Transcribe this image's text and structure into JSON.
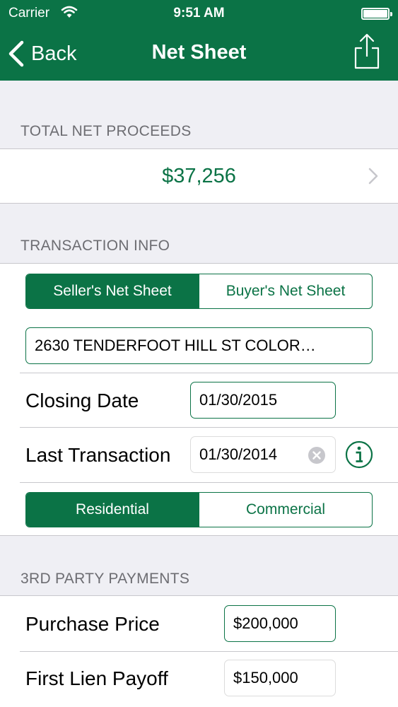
{
  "status_bar": {
    "carrier": "Carrier",
    "time": "9:51 AM"
  },
  "nav": {
    "back_label": "Back",
    "title": "Net Sheet"
  },
  "proceeds": {
    "header": "TOTAL NET PROCEEDS",
    "value": "$37,256"
  },
  "transaction": {
    "header": "TRANSACTION INFO",
    "sheet_type": {
      "options": [
        "Seller's Net Sheet",
        "Buyer's Net Sheet"
      ],
      "selected": "Seller's Net Sheet"
    },
    "address": "2630 TENDERFOOT HILL ST  COLOR…",
    "closing_date": {
      "label": "Closing Date",
      "value": "01/30/2015"
    },
    "last_transaction": {
      "label": "Last Transaction",
      "value": "01/30/2014"
    },
    "property_type": {
      "options": [
        "Residential",
        "Commercial"
      ],
      "selected": "Residential"
    }
  },
  "third_party": {
    "header": "3RD PARTY PAYMENTS",
    "purchase_price": {
      "label": "Purchase Price",
      "value": "$200,000"
    },
    "first_lien_payoff": {
      "label": "First Lien Payoff",
      "value": "$150,000"
    }
  },
  "colors": {
    "brand": "#0b7346",
    "background": "#efeff4",
    "separator": "#c8c7cc"
  },
  "icons": [
    "wifi-icon",
    "battery-icon",
    "back-chevron-icon",
    "share-icon",
    "chevron-right-icon",
    "clear-icon",
    "info-icon"
  ]
}
